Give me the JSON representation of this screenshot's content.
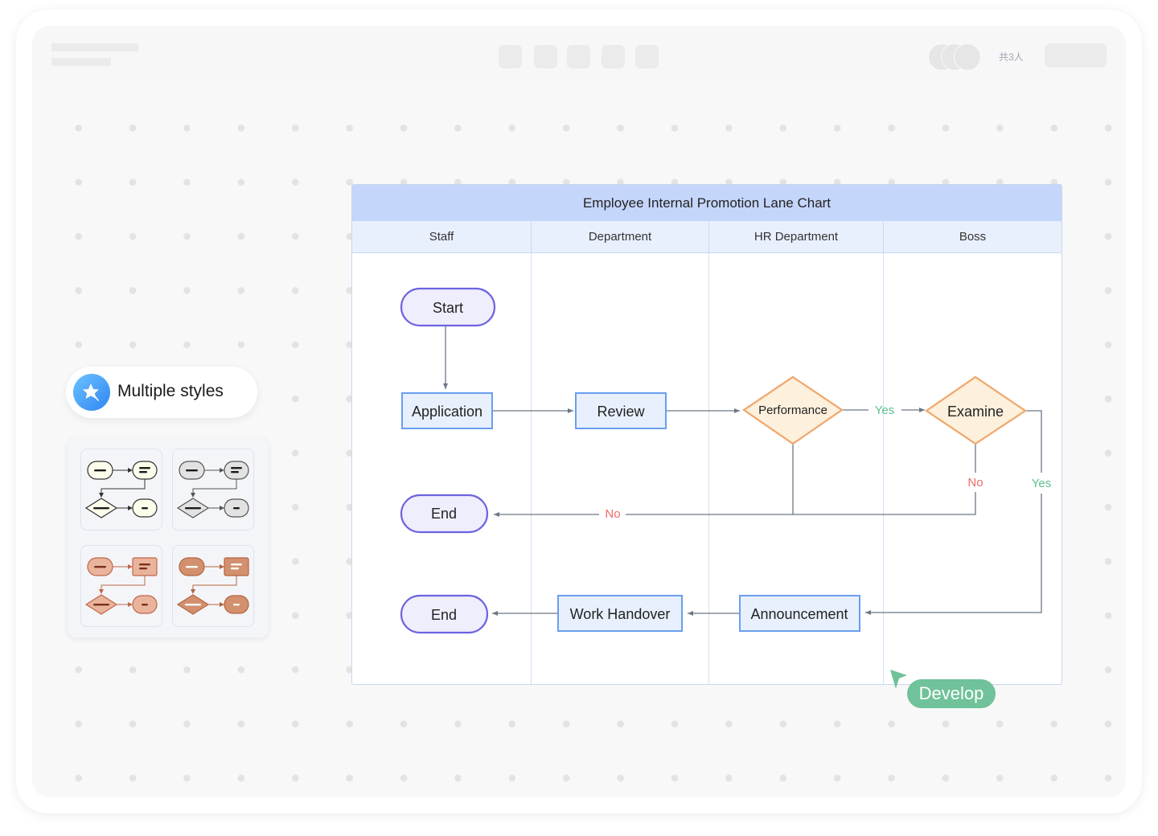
{
  "header": {
    "collaborator_count": "共3人",
    "toolbar_buttons": 5,
    "avatars": 3
  },
  "feature_badge": {
    "icon": "star-wand-icon",
    "label": "Multiple styles"
  },
  "style_presets": [
    {
      "name": "cream",
      "fill": "#fdfdec",
      "stroke": "#333333",
      "bar": "#1a1a1a",
      "decision_fill": "#fdfdec"
    },
    {
      "name": "gray",
      "fill": "#e2e2e2",
      "stroke": "#555555",
      "bar": "#1a1a1a",
      "decision_fill": "#e2e2e2"
    },
    {
      "name": "peach",
      "fill": "#eab49c",
      "stroke": "#c0674a",
      "bar": "#7a2e1c",
      "decision_fill": "#eab49c"
    },
    {
      "name": "terracotta",
      "fill": "#d3906e",
      "stroke": "#b4653f",
      "bar": "#ffffff",
      "decision_fill": "#d3906e"
    }
  ],
  "lane_chart": {
    "title": "Employee Internal Promotion Lane Chart",
    "lanes": [
      "Staff",
      "Department",
      "HR Department",
      "Boss"
    ],
    "nodes": {
      "start": "Start",
      "application": "Application",
      "review": "Review",
      "performance": "Performance",
      "examine": "Examine",
      "end1": "End",
      "end2": "End",
      "work_handover": "Work Handover",
      "announcement": "Announcement"
    },
    "edge_labels": {
      "perf_yes": "Yes",
      "exam_no": "No",
      "to_end_no": "No",
      "exam_yes": "Yes"
    },
    "colors": {
      "terminal_stroke": "#6c63e0",
      "terminal_fill": "#eeeefd",
      "process_stroke": "#6a9ef0",
      "process_fill": "#e8f0fe",
      "decision_stroke": "#f0a66a",
      "decision_fill": "#fdf0dc",
      "yes": "#5cbf8e",
      "no": "#ee6b6b",
      "edge": "#6b7785"
    }
  },
  "cursor_tag": {
    "label": "Develop",
    "color": "#6fc299"
  }
}
